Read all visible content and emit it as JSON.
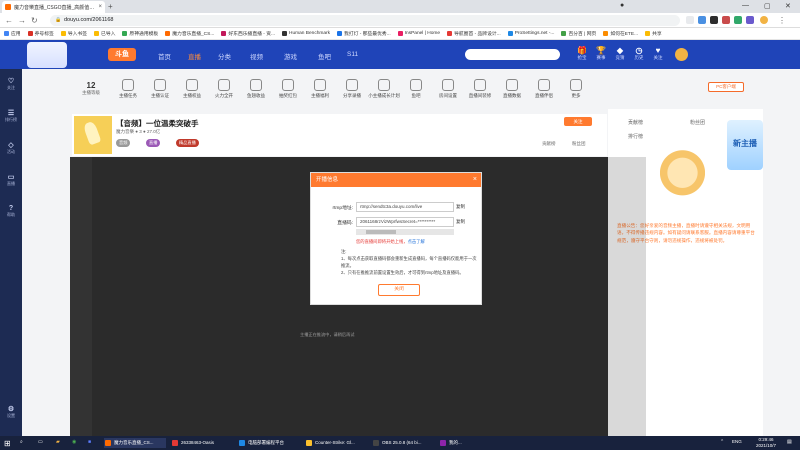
{
  "browser": {
    "tab_title": "魔力音樂直播_CSGO直播_高颜值…",
    "address": "douyu.com/2061168",
    "bookmarks": [
      "应用",
      "养号标签",
      "导入书签",
      "已导入",
      "原神通用模板",
      "魔力音乐直播_CS...",
      "好东西乐播直播 - 资...",
      "Human Benchmark",
      "我打灯 - 那些最优秀...",
      "InsPanel | Home",
      "导航圈首 - 品牌设计...",
      "ProSettings.net -...",
      "百分百 | 网页",
      "...",
      "如何在ETE...",
      "共享"
    ]
  },
  "site": {
    "logo": "斗鱼",
    "nav": [
      "首页",
      "直播",
      "分类",
      "视频",
      "游戏",
      "鱼吧",
      "S11"
    ],
    "header_icons": [
      "抢宝",
      "赛事",
      "竞猜",
      "历史",
      "关注",
      "登录"
    ]
  },
  "sidebar": [
    "关注",
    "排行榜",
    "活动",
    "直播",
    "帮助",
    "设置"
  ],
  "function_bar": {
    "fans_count": "12",
    "fans_label": "主播等级",
    "items": [
      "主播等级",
      "主播任务",
      "主播认证",
      "主播权益",
      "火力全开",
      "鱼翅收益",
      "抽奖红包",
      "主播福利",
      "分享录播",
      "小主播成长计划",
      "鱼吧",
      "房间设置",
      "直播间装修",
      "直播数据",
      "直播伴侣",
      "更多"
    ],
    "pc_button": "PC客户端"
  },
  "room": {
    "title": "【音频】一位温柔突破手",
    "meta": "魔力音樂   ● 3   ● 27.0亿",
    "tags": [
      "音频",
      "直播",
      "精品直播"
    ],
    "follow": "关注",
    "tabs": [
      "贡献榜",
      "粉丝团"
    ],
    "player_hint": "主播正在推流中，请稍后再试"
  },
  "right_panel": {
    "tabs": [
      "贡献榜",
      "粉丝团",
      "排行榜"
    ],
    "announcement": "直播公告：您好亲爱的音频主播，直播时请遵守相关法规，文明用语，不得传播违规内容。如有疑问请联系客服。直播内容请尊重平台规范，遵守平台守则，请勿违规操作，违规将被处罚。",
    "side_banner": "新主播"
  },
  "modal": {
    "title": "开播信息",
    "close_icon": "×",
    "rtmp_label": "rtmp地址:",
    "rtmp_value": "rtmp://sendtc3a.douyu.com/live",
    "code_label": "直播码:",
    "code_value": "2061168rzVizWprfwsSecret=**********",
    "copy_label": "复制",
    "warning": "您的直播间即将开始上线，",
    "warning_link": "点击了解",
    "notes_title": "注:",
    "notes": [
      "1、每次点击获取直播码都会重新生成直播码，每个直播码仅能用于一次推流。",
      "2、只有在推推流前置设置生效后，才可得到rtmp地址及直播码。"
    ],
    "button": "关闭"
  },
  "taskbar": {
    "items": [
      "魔力音乐直播_CS...",
      "26338463-Oasis",
      "电脑部署编程平台",
      "Counter-Strike: Gl...",
      "OBS 25.0.8 (64 bi...",
      "我的..."
    ],
    "time": "0:29:46",
    "date": "2021/10/7",
    "lang": "ENG"
  }
}
